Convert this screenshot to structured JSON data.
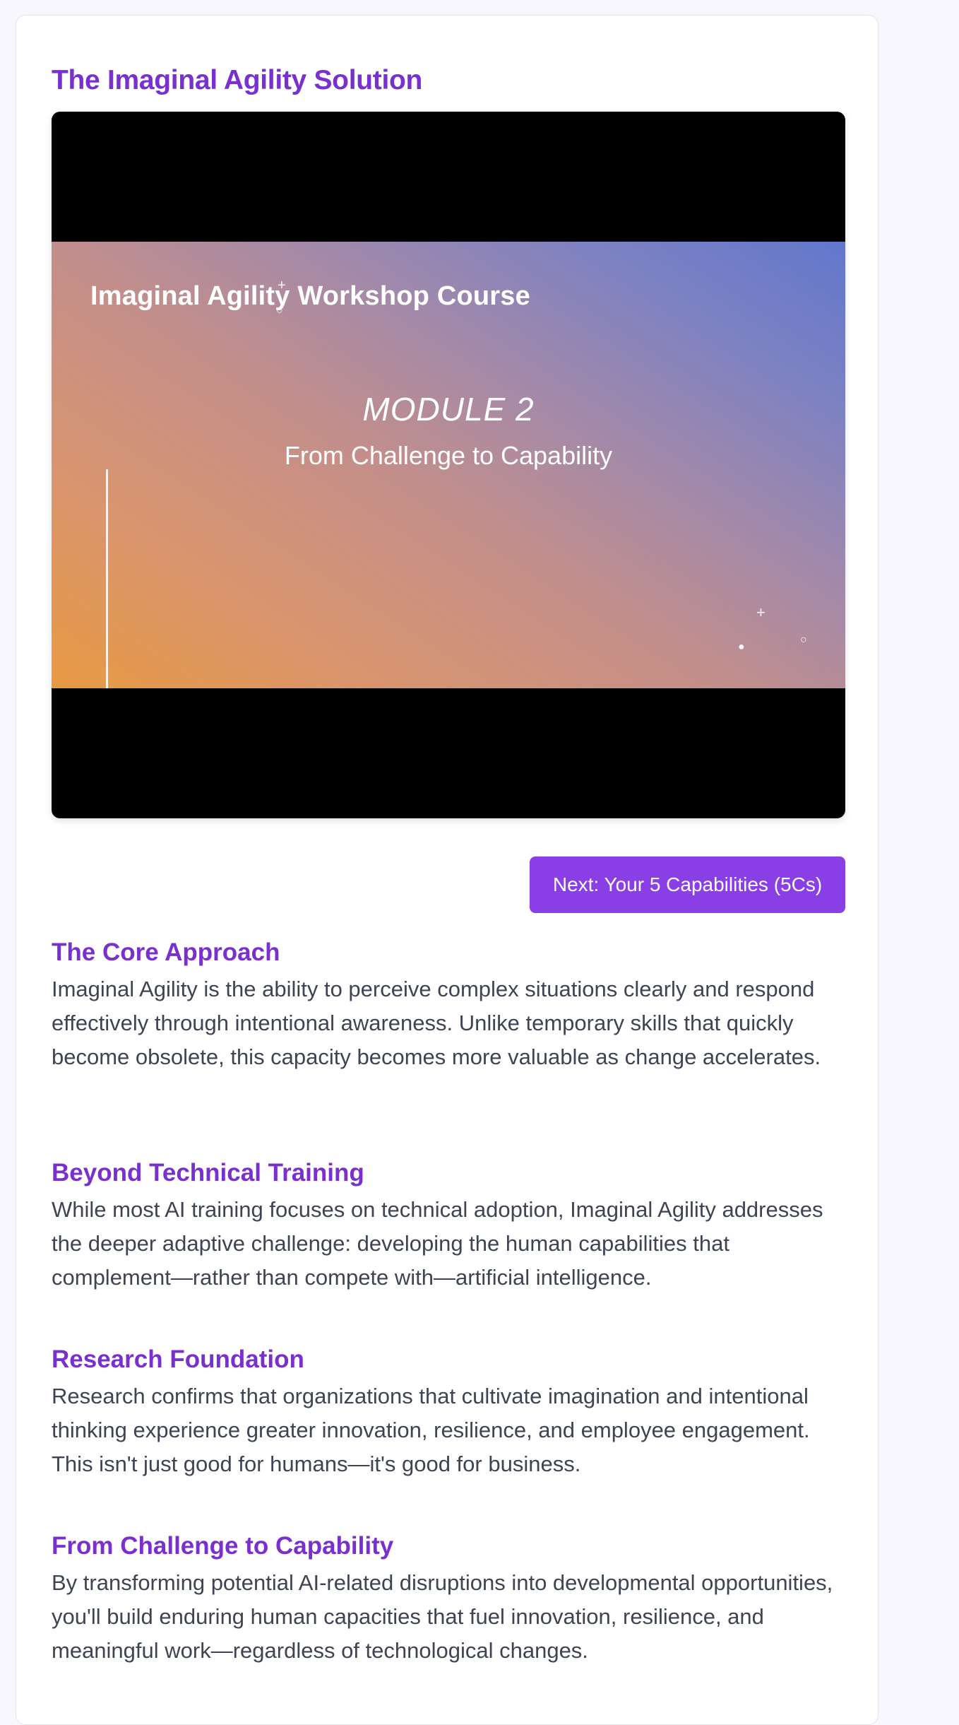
{
  "page_title": "The Imaginal Agility Solution",
  "video": {
    "frame_title": "Imaginal Agility Workshop Course",
    "module_label": "MODULE 2",
    "module_subtitle": "From Challenge to Capability"
  },
  "next_button_label": "Next: Your 5 Capabilities (5Cs)",
  "sections": [
    {
      "heading": "The Core Approach",
      "body": "Imaginal Agility is the ability to perceive complex situations clearly and respond effectively through intentional awareness. Unlike temporary skills that quickly become obsolete, this capacity becomes more valuable as change accelerates."
    },
    {
      "heading": "Beyond Technical Training",
      "body": "While most AI training focuses on technical adoption, Imaginal Agility addresses the deeper adaptive challenge: developing the human capabilities that complement—rather than compete with—artificial intelligence."
    },
    {
      "heading": "Research Foundation",
      "body": "Research confirms that organizations that cultivate imagination and intentional thinking experience greater innovation, resilience, and employee engagement. This isn't just good for humans—it's good for business."
    },
    {
      "heading": "From Challenge to Capability",
      "body": "By transforming potential AI-related disruptions into developmental opportunities, you'll build enduring human capacities that fuel innovation, resilience, and meaningful work—regardless of technological changes."
    }
  ],
  "colors": {
    "accent": "#7a2fcf",
    "button": "#8a3ee6",
    "body_text": "#3f4453",
    "page_background": "#f7f7fd"
  }
}
